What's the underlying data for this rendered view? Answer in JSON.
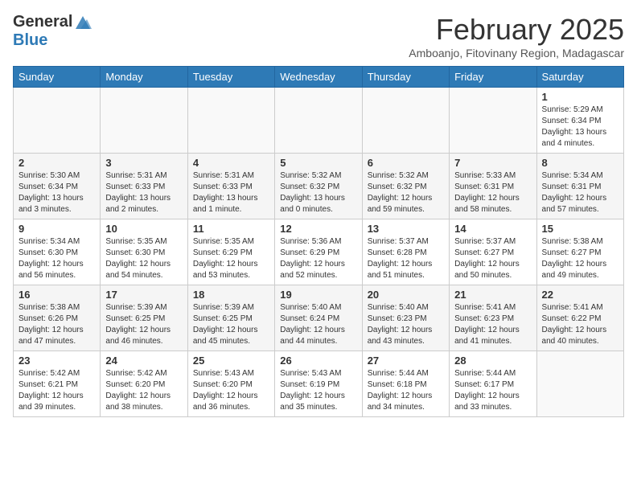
{
  "header": {
    "logo_general": "General",
    "logo_blue": "Blue",
    "month_title": "February 2025",
    "subtitle": "Amboanjo, Fitovinany Region, Madagascar"
  },
  "weekdays": [
    "Sunday",
    "Monday",
    "Tuesday",
    "Wednesday",
    "Thursday",
    "Friday",
    "Saturday"
  ],
  "weeks": [
    [
      {
        "day": "",
        "info": ""
      },
      {
        "day": "",
        "info": ""
      },
      {
        "day": "",
        "info": ""
      },
      {
        "day": "",
        "info": ""
      },
      {
        "day": "",
        "info": ""
      },
      {
        "day": "",
        "info": ""
      },
      {
        "day": "1",
        "info": "Sunrise: 5:29 AM\nSunset: 6:34 PM\nDaylight: 13 hours\nand 4 minutes."
      }
    ],
    [
      {
        "day": "2",
        "info": "Sunrise: 5:30 AM\nSunset: 6:34 PM\nDaylight: 13 hours\nand 3 minutes."
      },
      {
        "day": "3",
        "info": "Sunrise: 5:31 AM\nSunset: 6:33 PM\nDaylight: 13 hours\nand 2 minutes."
      },
      {
        "day": "4",
        "info": "Sunrise: 5:31 AM\nSunset: 6:33 PM\nDaylight: 13 hours\nand 1 minute."
      },
      {
        "day": "5",
        "info": "Sunrise: 5:32 AM\nSunset: 6:32 PM\nDaylight: 13 hours\nand 0 minutes."
      },
      {
        "day": "6",
        "info": "Sunrise: 5:32 AM\nSunset: 6:32 PM\nDaylight: 12 hours\nand 59 minutes."
      },
      {
        "day": "7",
        "info": "Sunrise: 5:33 AM\nSunset: 6:31 PM\nDaylight: 12 hours\nand 58 minutes."
      },
      {
        "day": "8",
        "info": "Sunrise: 5:34 AM\nSunset: 6:31 PM\nDaylight: 12 hours\nand 57 minutes."
      }
    ],
    [
      {
        "day": "9",
        "info": "Sunrise: 5:34 AM\nSunset: 6:30 PM\nDaylight: 12 hours\nand 56 minutes."
      },
      {
        "day": "10",
        "info": "Sunrise: 5:35 AM\nSunset: 6:30 PM\nDaylight: 12 hours\nand 54 minutes."
      },
      {
        "day": "11",
        "info": "Sunrise: 5:35 AM\nSunset: 6:29 PM\nDaylight: 12 hours\nand 53 minutes."
      },
      {
        "day": "12",
        "info": "Sunrise: 5:36 AM\nSunset: 6:29 PM\nDaylight: 12 hours\nand 52 minutes."
      },
      {
        "day": "13",
        "info": "Sunrise: 5:37 AM\nSunset: 6:28 PM\nDaylight: 12 hours\nand 51 minutes."
      },
      {
        "day": "14",
        "info": "Sunrise: 5:37 AM\nSunset: 6:27 PM\nDaylight: 12 hours\nand 50 minutes."
      },
      {
        "day": "15",
        "info": "Sunrise: 5:38 AM\nSunset: 6:27 PM\nDaylight: 12 hours\nand 49 minutes."
      }
    ],
    [
      {
        "day": "16",
        "info": "Sunrise: 5:38 AM\nSunset: 6:26 PM\nDaylight: 12 hours\nand 47 minutes."
      },
      {
        "day": "17",
        "info": "Sunrise: 5:39 AM\nSunset: 6:25 PM\nDaylight: 12 hours\nand 46 minutes."
      },
      {
        "day": "18",
        "info": "Sunrise: 5:39 AM\nSunset: 6:25 PM\nDaylight: 12 hours\nand 45 minutes."
      },
      {
        "day": "19",
        "info": "Sunrise: 5:40 AM\nSunset: 6:24 PM\nDaylight: 12 hours\nand 44 minutes."
      },
      {
        "day": "20",
        "info": "Sunrise: 5:40 AM\nSunset: 6:23 PM\nDaylight: 12 hours\nand 43 minutes."
      },
      {
        "day": "21",
        "info": "Sunrise: 5:41 AM\nSunset: 6:23 PM\nDaylight: 12 hours\nand 41 minutes."
      },
      {
        "day": "22",
        "info": "Sunrise: 5:41 AM\nSunset: 6:22 PM\nDaylight: 12 hours\nand 40 minutes."
      }
    ],
    [
      {
        "day": "23",
        "info": "Sunrise: 5:42 AM\nSunset: 6:21 PM\nDaylight: 12 hours\nand 39 minutes."
      },
      {
        "day": "24",
        "info": "Sunrise: 5:42 AM\nSunset: 6:20 PM\nDaylight: 12 hours\nand 38 minutes."
      },
      {
        "day": "25",
        "info": "Sunrise: 5:43 AM\nSunset: 6:20 PM\nDaylight: 12 hours\nand 36 minutes."
      },
      {
        "day": "26",
        "info": "Sunrise: 5:43 AM\nSunset: 6:19 PM\nDaylight: 12 hours\nand 35 minutes."
      },
      {
        "day": "27",
        "info": "Sunrise: 5:44 AM\nSunset: 6:18 PM\nDaylight: 12 hours\nand 34 minutes."
      },
      {
        "day": "28",
        "info": "Sunrise: 5:44 AM\nSunset: 6:17 PM\nDaylight: 12 hours\nand 33 minutes."
      },
      {
        "day": "",
        "info": ""
      }
    ]
  ]
}
